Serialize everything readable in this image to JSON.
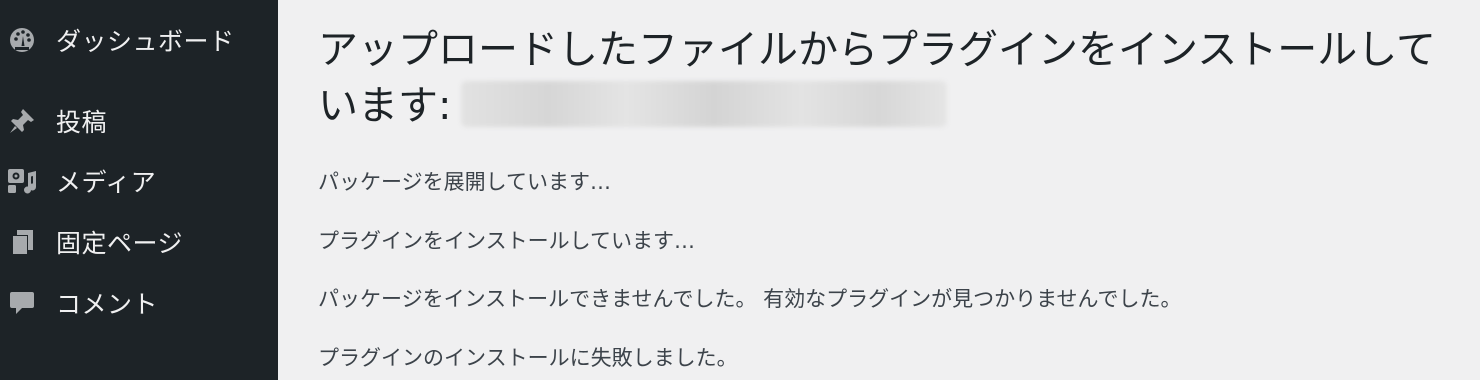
{
  "sidebar": {
    "items": [
      {
        "label": "ダッシュボード",
        "icon": "dashboard-icon"
      },
      {
        "label": "投稿",
        "icon": "pin-icon"
      },
      {
        "label": "メディア",
        "icon": "media-icon"
      },
      {
        "label": "固定ページ",
        "icon": "pages-icon"
      },
      {
        "label": "コメント",
        "icon": "comment-icon"
      }
    ]
  },
  "main": {
    "title": "アップロードしたファイルからプラグインをインストールしています:",
    "messages": [
      "パッケージを展開しています…",
      "プラグインをインストールしています…",
      "パッケージをインストールできませんでした。 有効なプラグインが見つかりませんでした。",
      "プラグインのインストールに失敗しました。"
    ]
  },
  "colors": {
    "sidebar_bg": "#1d2327",
    "sidebar_text": "#f0f0f1",
    "icon_color": "#a7aaad",
    "page_bg": "#f0f0f1",
    "title_text": "#1d2327",
    "body_text": "#3c434a"
  }
}
